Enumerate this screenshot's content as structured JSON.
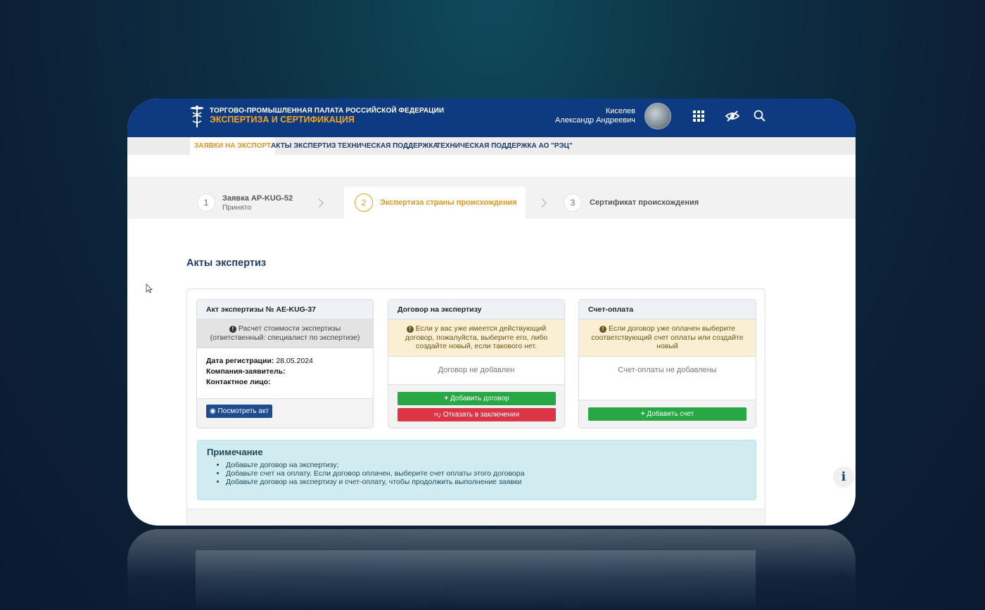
{
  "header": {
    "org_line1": "ТОРГОВО-ПРОМЫШЛЕННАЯ ПАЛАТА РОССИЙСКОЙ ФЕДЕРАЦИИ",
    "org_line2": "ЭКСПЕРТИЗА И СЕРТИФИКАЦИЯ",
    "user_last": "Киселев",
    "user_first": "Александр Андреевич",
    "icons": [
      "apps-grid-icon",
      "visibility-off-icon",
      "search-icon"
    ]
  },
  "nav": {
    "items": [
      {
        "label": "ЗАЯВКИ НА ЭКСПОРТ",
        "active": true
      },
      {
        "label": "АКТЫ ЭКСПЕРТИЗ",
        "active": false
      },
      {
        "label": "ТЕХНИЧЕСКАЯ ПОДДЕРЖКА",
        "active": false
      },
      {
        "label": "ТЕХНИЧЕСКАЯ ПОДДЕРЖКА АО \"РЭЦ\"",
        "active": false
      }
    ]
  },
  "stepper": {
    "steps": [
      {
        "num": "1",
        "title": "Заявка AP-KUG-52",
        "subtitle": "Принято"
      },
      {
        "num": "2",
        "title": "Экспертиза страны происхождения",
        "subtitle": ""
      },
      {
        "num": "3",
        "title": "Сертификат происхождения",
        "subtitle": ""
      }
    ]
  },
  "section_title": "Акты экспертиз",
  "cards": {
    "act": {
      "title": "Акт экспертизы № AE-KUG-37",
      "message": "Расчет стоимости экспертизы (ответственный: специалист по экспертизе)",
      "date_label": "Дата регистрации:",
      "date_value": "28.05.2024",
      "company_label": "Компания-заявитель:",
      "contact_label": "Контактное лицо:",
      "view_button": "Посмотреть акт"
    },
    "contract": {
      "title": "Договор на экспертизу",
      "message": "Если у вас уже имеется действующий договор, пожалуйста, выберите его, либо создайте новый, если такового нет.",
      "empty": "Договор не добавлен",
      "add_button": "Добавить договор",
      "reject_button": "Отказать в заключении"
    },
    "invoice": {
      "title": "Счет-оплата",
      "message": "Если договор уже оплачен выберите соответствующий счет оплаты или создайте новый",
      "empty": "Счет-оплаты не добавлены",
      "add_button": "Добавить счет"
    }
  },
  "note": {
    "title": "Примечание",
    "items": [
      "Добавьте договор на экспертизу;",
      "Добавьте счет на оплату. Если договор оплачен, выберите счет оплаты этого договора",
      "Добавьте договор на экспертизу и счет-оплату, чтобы продолжить выполнение заявки"
    ]
  },
  "colors": {
    "header_bg": "#0d3a80",
    "accent": "#e5951f",
    "success": "#28a745",
    "danger": "#dc3545",
    "note_bg": "#d1ecf1"
  }
}
